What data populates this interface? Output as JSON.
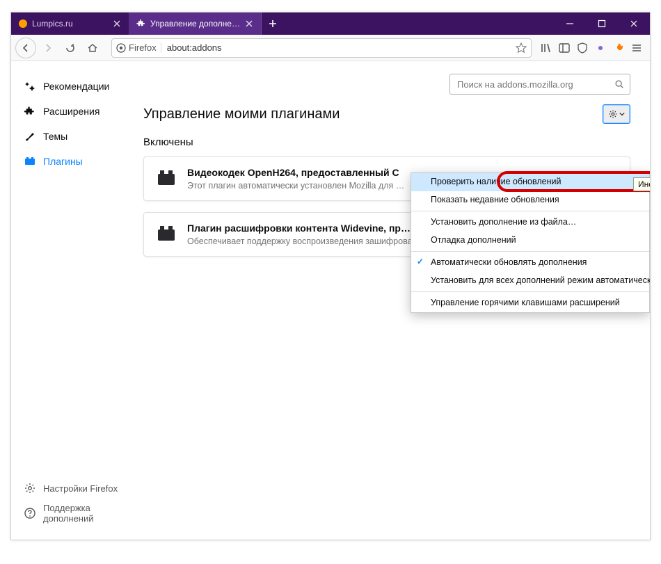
{
  "tabs": [
    {
      "label": "Lumpics.ru",
      "favicon": "orange-dot"
    },
    {
      "label": "Управление дополнениями",
      "favicon": "puzzle"
    }
  ],
  "urlbar": {
    "identity_label": "Firefox",
    "url": "about:addons"
  },
  "sidebar": {
    "items": [
      {
        "key": "recommend",
        "label": "Рекомендации"
      },
      {
        "key": "extensions",
        "label": "Расширения"
      },
      {
        "key": "themes",
        "label": "Темы"
      },
      {
        "key": "plugins",
        "label": "Плагины"
      }
    ],
    "footer": [
      {
        "key": "settings",
        "label": "Настройки Firefox"
      },
      {
        "key": "support",
        "label": "Поддержка дополнений"
      }
    ]
  },
  "search": {
    "placeholder": "Поиск на addons.mozilla.org"
  },
  "page": {
    "title": "Управление моими плагинами",
    "section_enabled": "Включены"
  },
  "plugins": [
    {
      "title": "Видеокодек OpenH264, предоставленный C",
      "desc": "Этот плагин автоматически установлен Mozilla для …"
    },
    {
      "title": "Плагин расшифровки контента Widevine, пр…",
      "desc": "Обеспечивает поддержку воспроизведения зашифрованного медиа в соответст…"
    }
  ],
  "dropdown": {
    "items": [
      "Проверить наличие обновлений",
      "Показать недавние обновления",
      "Установить дополнение из файла…",
      "Отладка дополнений",
      "Автоматически обновлять дополнения",
      "Установить для всех дополнений режим автоматического обновления",
      "Управление горячими клавишами расширений"
    ],
    "checked_index": 4,
    "highlighted_index": 0
  },
  "tooltip": "Инструменты для всех дополнений"
}
